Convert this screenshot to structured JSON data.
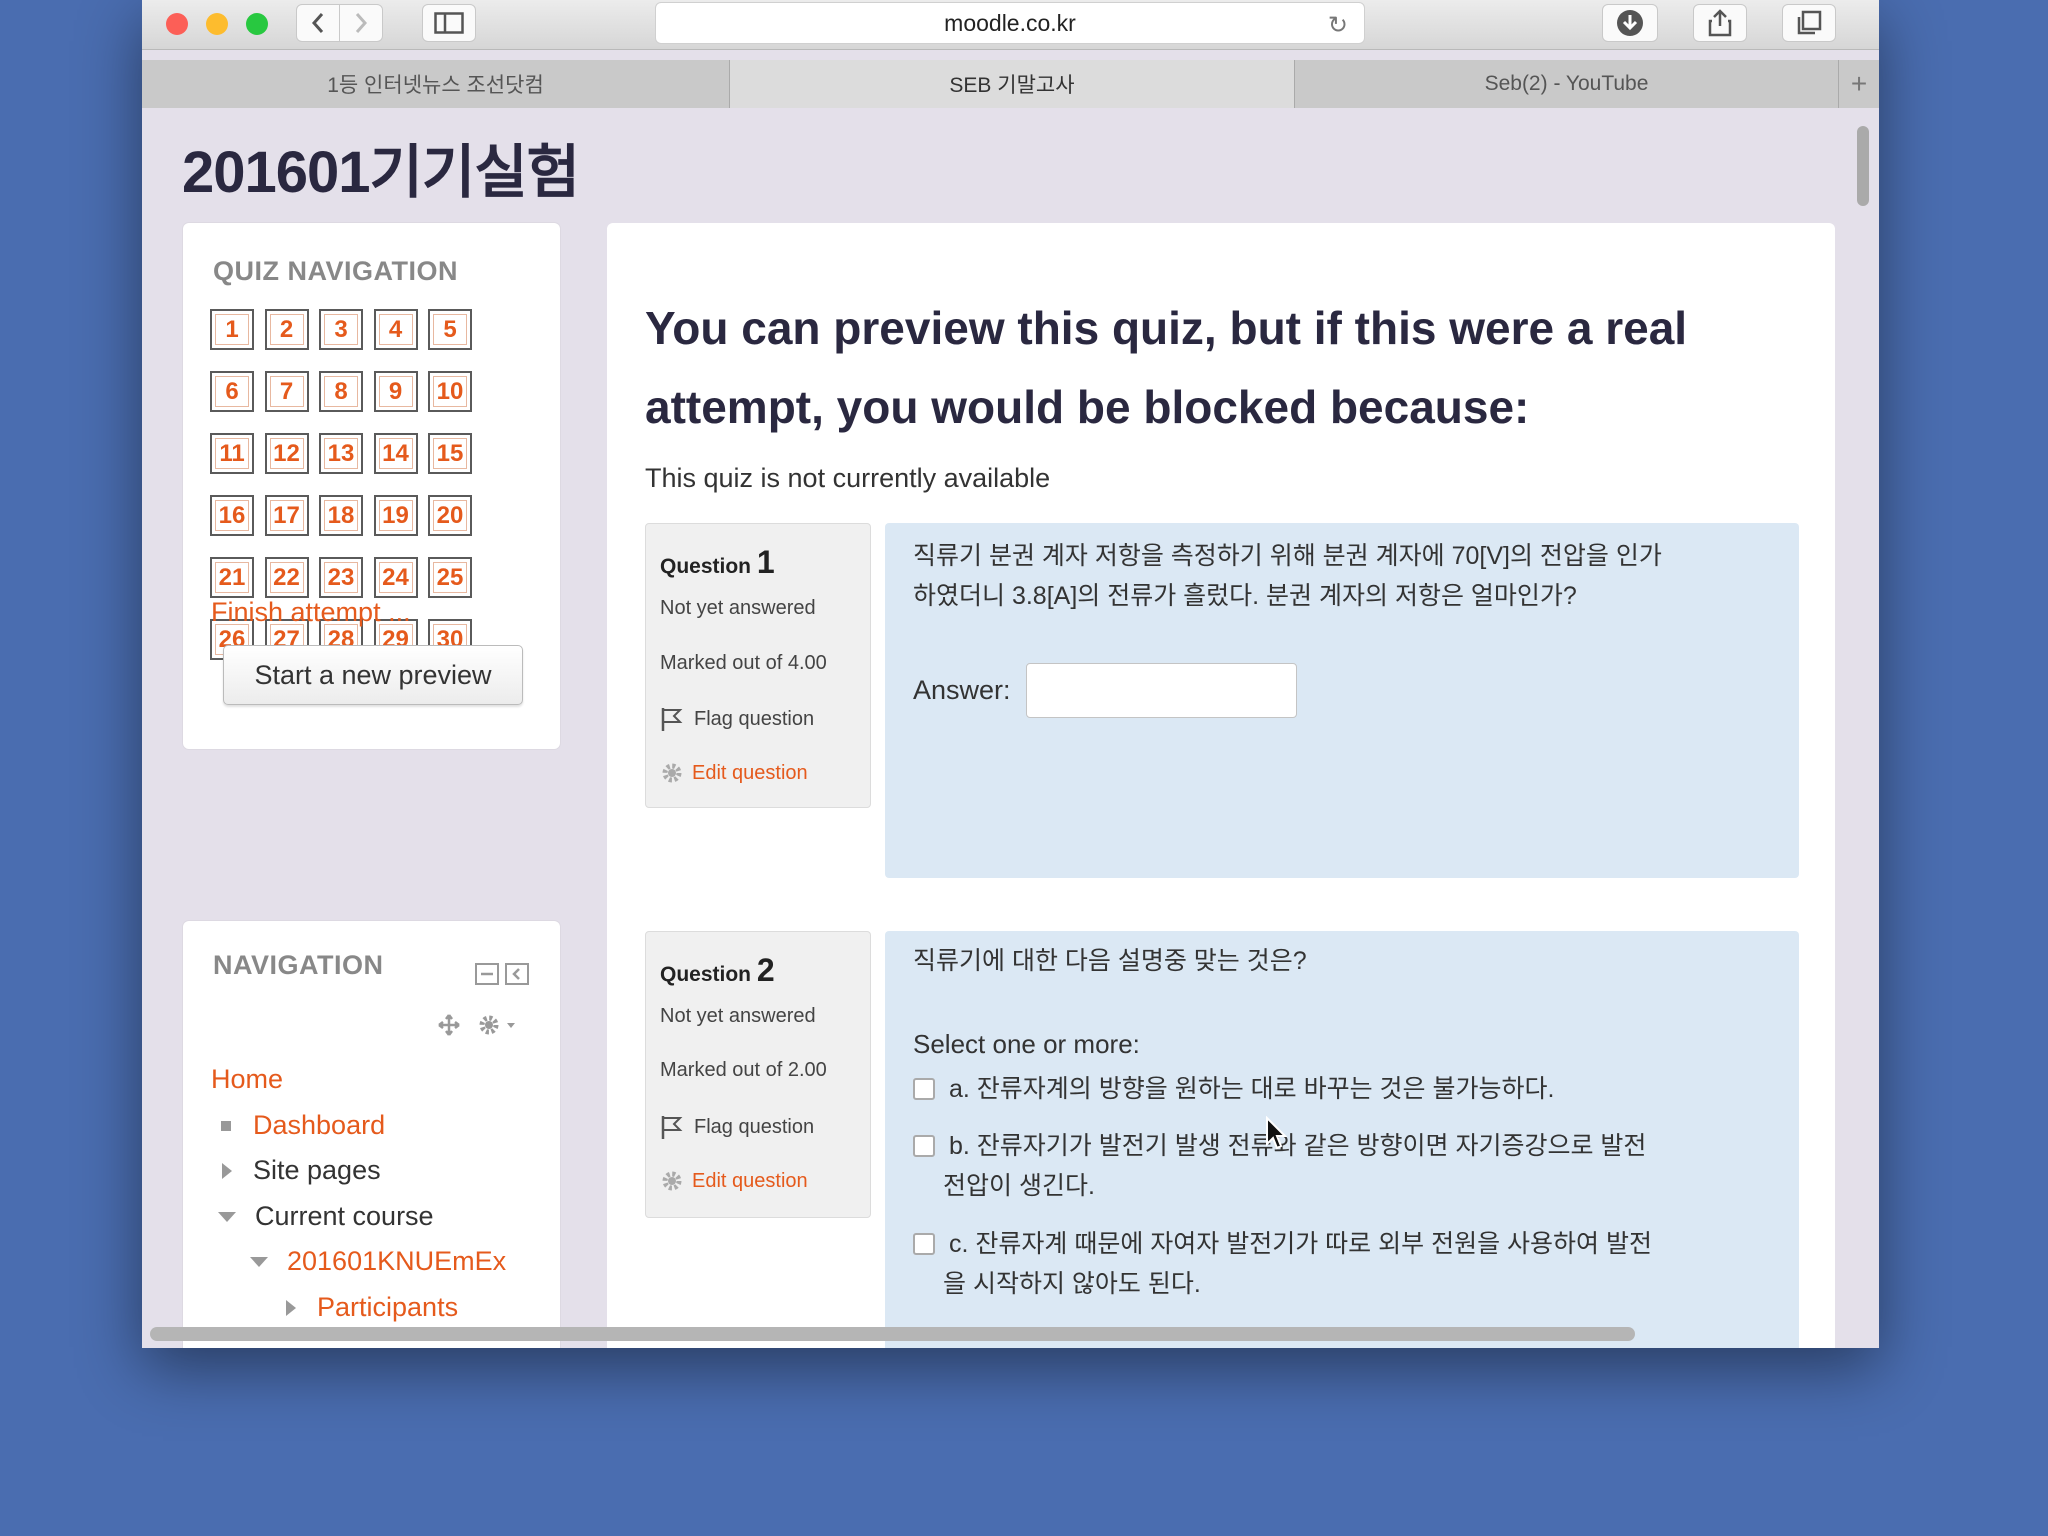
{
  "browser": {
    "url": "moodle.co.kr",
    "tabs": [
      "1등 인터넷뉴스 조선닷컴",
      "SEB 기말고사",
      "Seb(2) - YouTube"
    ],
    "active_tab": 1,
    "new_tab_label": "+"
  },
  "site_title": "201601기기실험",
  "quiz_nav": {
    "title": "QUIZ NAVIGATION",
    "questions": [
      "1",
      "2",
      "3",
      "4",
      "5",
      "6",
      "7",
      "8",
      "9",
      "10",
      "11",
      "12",
      "13",
      "14",
      "15",
      "16",
      "17",
      "18",
      "19",
      "20",
      "21",
      "22",
      "23",
      "24",
      "25",
      "26",
      "27",
      "28",
      "29",
      "30"
    ],
    "finish_link": "Finish attempt ...",
    "preview_button": "Start a new preview"
  },
  "navigation": {
    "title": "NAVIGATION",
    "home": "Home",
    "dashboard": "Dashboard",
    "site_pages": "Site pages",
    "current_course": "Current course",
    "course": "201601KNUEmEx",
    "participants": "Participants"
  },
  "main": {
    "heading": "You can preview this quiz, but if this were a real attempt, you would be blocked because:",
    "notice": "This quiz is not currently available"
  },
  "questions": [
    {
      "label": "Question",
      "number": "1",
      "state": "Not yet answered",
      "marks": "Marked out of 4.00",
      "flag": "Flag question",
      "edit": "Edit question",
      "text_line1": "직류기 분권 계자 저항을 측정하기 위해 분권 계자에 70[V]의 전압을 인가",
      "text_line2": "하였더니 3.8[A]의 전류가 흘렀다. 분권 계자의 저항은 얼마인가?",
      "answer_label": "Answer:",
      "answer_value": ""
    },
    {
      "label": "Question",
      "number": "2",
      "state": "Not yet answered",
      "marks": "Marked out of 2.00",
      "flag": "Flag question",
      "edit": "Edit question",
      "text": "직류기에 대한 다음 설명중 맞는 것은?",
      "prompt": "Select one or more:",
      "options": [
        {
          "line1": "a. 잔류자계의 방향을 원하는 대로 바꾸는 것은 불가능하다.",
          "line2": ""
        },
        {
          "line1": "b. 잔류자기가 발전기 발생 전류와 같은 방향이면 자기증강으로 발전",
          "line2": "전압이 생긴다."
        },
        {
          "line1": "c. 잔류자계 때문에 자여자 발전기가 따로 외부 전원을 사용하여 발전",
          "line2": "을 시작하지 않아도 된다."
        }
      ]
    }
  ],
  "colors": {
    "desktop": "#4a6db0",
    "page_bg": "#e4e0ea",
    "link": "#e55a1c",
    "question_bg": "#dbe8f4",
    "heading": "#2a2840"
  },
  "icons": [
    "close-light",
    "minimize-light",
    "zoom-light",
    "back-icon",
    "forward-icon",
    "sidebar-icon",
    "reload-icon",
    "download-icon",
    "share-icon",
    "tabs-icon",
    "flag-icon",
    "gear-icon",
    "move-icon",
    "dock-icon",
    "collapse-icon",
    "bullet-icon",
    "triangle-right-icon",
    "triangle-down-icon",
    "mouse-cursor-icon"
  ]
}
